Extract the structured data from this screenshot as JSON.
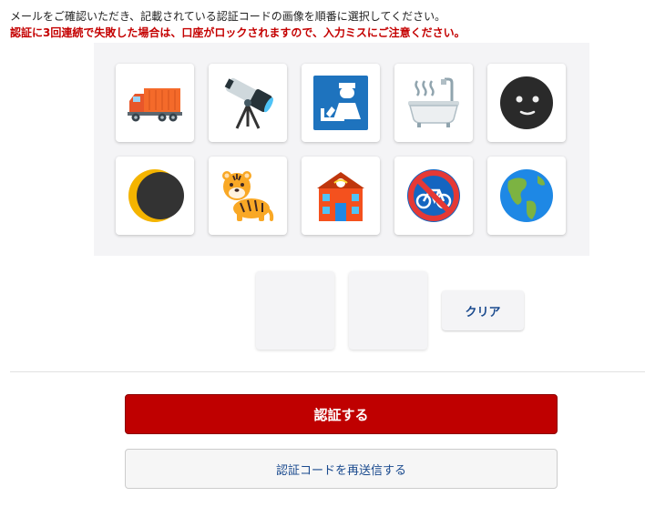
{
  "instructions": {
    "line1": "メールをご確認いただき、記載されている認証コードの画像を順番に選択してください。",
    "line2": "認証に3回連続で失敗した場合は、口座がロックされますので、入力ミスにご注意ください。"
  },
  "image_grid": {
    "tiles": [
      {
        "icon": "delivery-truck-icon"
      },
      {
        "icon": "telescope-icon"
      },
      {
        "icon": "customs-icon"
      },
      {
        "icon": "bathtub-icon"
      },
      {
        "icon": "new-moon-face-icon"
      },
      {
        "icon": "waxing-crescent-moon-icon"
      },
      {
        "icon": "tiger-icon"
      },
      {
        "icon": "post-office-icon"
      },
      {
        "icon": "no-bicycles-icon"
      },
      {
        "icon": "globe-americas-icon"
      }
    ]
  },
  "selection": {
    "slots": [
      "",
      ""
    ],
    "clear_label": "クリア"
  },
  "actions": {
    "submit_label": "認証する",
    "resend_label": "認証コードを再送信する"
  },
  "colors": {
    "primary": "#bf0000",
    "warning_text": "#c40000",
    "link_text": "#1a4a8e",
    "panel_bg": "#f4f4f6"
  }
}
